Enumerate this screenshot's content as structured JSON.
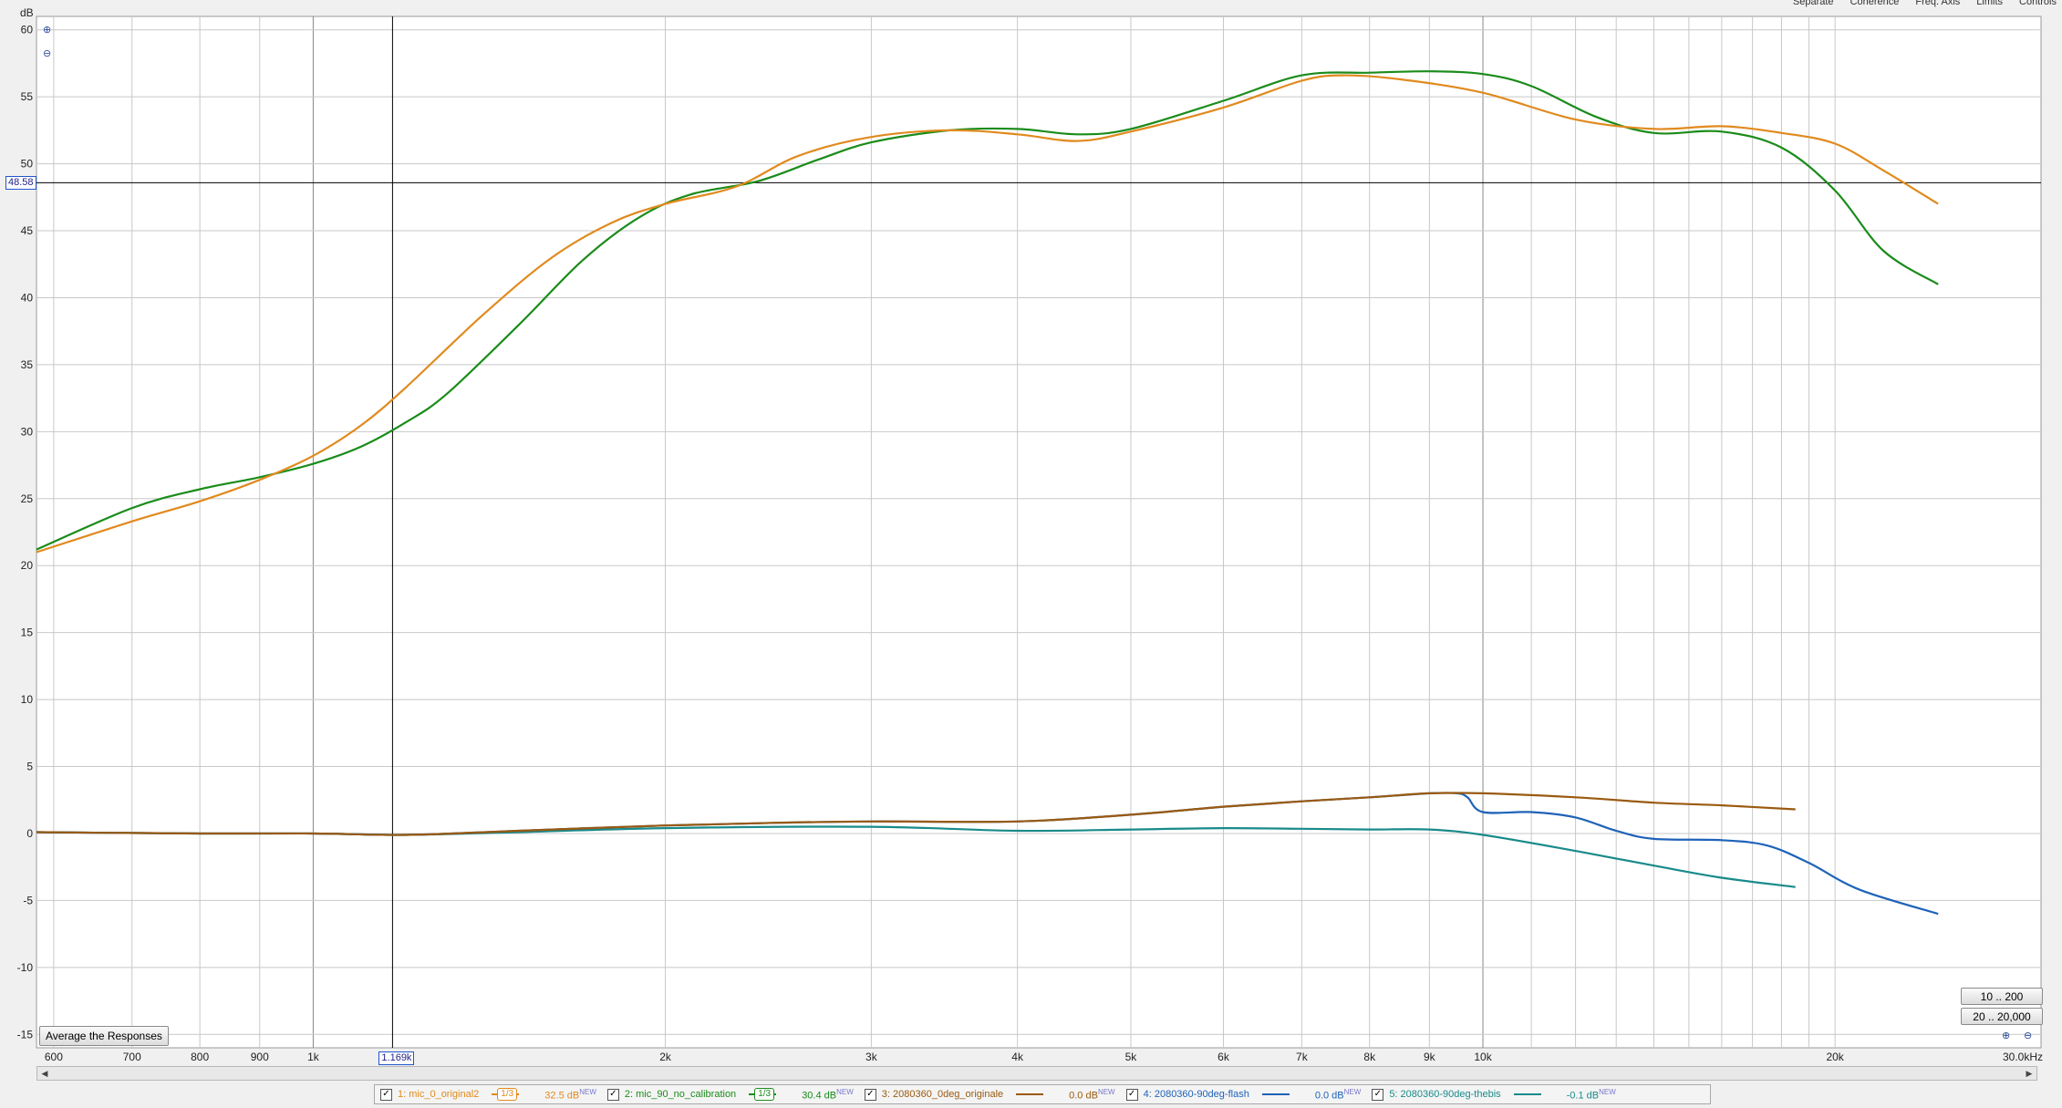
{
  "header": {
    "y_unit": "dB",
    "menu_items": [
      "Separate",
      "Coherence",
      "Freq. Axis",
      "Limits",
      "Controls"
    ]
  },
  "cursor": {
    "freq_label": "1.169k",
    "db_label": "48.58",
    "freq": 1169,
    "db": 48.58
  },
  "buttons": {
    "average": "Average the Responses",
    "range_low": "10 .. 200",
    "range_full": "20 .. 20,000"
  },
  "colors": {
    "grid": "#c8c8c8",
    "grid_major": "#888888",
    "cursor": "#000000",
    "orange": "#e08a1e",
    "green": "#1a8c1a",
    "brown": "#9a5a10",
    "blue": "#1f63b8",
    "teal": "#1a8a8a"
  },
  "legend": [
    {
      "label": "1: mic_0_original2",
      "smoothing": "1/3",
      "offset": "32.5 dB",
      "color": "#e08a1e"
    },
    {
      "label": "2: mic_90_no_calibration",
      "smoothing": "1/3",
      "offset": "30.4 dB",
      "color": "#1a8c1a"
    },
    {
      "label": "3: 2080360_0deg_originale",
      "smoothing": "",
      "offset": "0.0 dB",
      "color": "#9a5a10"
    },
    {
      "label": "4: 2080360-90deg-flash",
      "smoothing": "",
      "offset": "0.0 dB",
      "color": "#1f63b8"
    },
    {
      "label": "5: 2080360-90deg-thebis",
      "smoothing": "",
      "offset": "-0.1 dB",
      "color": "#1a8a8a"
    }
  ],
  "legend_new_tag": "NEW",
  "chart_data": {
    "type": "line",
    "title": "",
    "xlabel": "",
    "ylabel": "dB",
    "x_scale": "log",
    "xlim": [
      580,
      30000
    ],
    "ylim": [
      -16,
      61
    ],
    "grid": true,
    "x_ticks": [
      {
        "v": 600,
        "label": "600"
      },
      {
        "v": 700,
        "label": "700"
      },
      {
        "v": 800,
        "label": "800"
      },
      {
        "v": 900,
        "label": "900"
      },
      {
        "v": 1000,
        "label": "1k"
      },
      {
        "v": 2000,
        "label": "2k"
      },
      {
        "v": 3000,
        "label": "3k"
      },
      {
        "v": 4000,
        "label": "4k"
      },
      {
        "v": 5000,
        "label": "5k"
      },
      {
        "v": 6000,
        "label": "6k"
      },
      {
        "v": 7000,
        "label": "7k"
      },
      {
        "v": 8000,
        "label": "8k"
      },
      {
        "v": 9000,
        "label": "9k"
      },
      {
        "v": 10000,
        "label": "10k"
      },
      {
        "v": 20000,
        "label": "20k"
      },
      {
        "v": 30000,
        "label": "30.0kHz"
      }
    ],
    "major_x": [
      1000,
      10000
    ],
    "extra_x_grid": [
      11000,
      12000,
      13000,
      14000,
      15000,
      16000,
      17000,
      18000,
      19000
    ],
    "y_ticks": [
      60,
      55,
      50,
      45,
      40,
      35,
      30,
      25,
      20,
      15,
      10,
      5,
      0,
      -5,
      -10,
      -15
    ],
    "series": [
      {
        "name": "1: mic_0_original2",
        "color": "#e08a1e",
        "points": [
          [
            580,
            21
          ],
          [
            700,
            23.3
          ],
          [
            800,
            24.8
          ],
          [
            900,
            26.4
          ],
          [
            1000,
            28.2
          ],
          [
            1100,
            30.5
          ],
          [
            1200,
            33.3
          ],
          [
            1400,
            38.8
          ],
          [
            1600,
            43
          ],
          [
            1800,
            45.6
          ],
          [
            2000,
            47
          ],
          [
            2300,
            48.3
          ],
          [
            2600,
            50.6
          ],
          [
            3000,
            52
          ],
          [
            3500,
            52.5
          ],
          [
            4000,
            52.2
          ],
          [
            4500,
            51.7
          ],
          [
            5000,
            52.4
          ],
          [
            6000,
            54.2
          ],
          [
            7000,
            56.2
          ],
          [
            7600,
            56.6
          ],
          [
            8500,
            56.3
          ],
          [
            10000,
            55.3
          ],
          [
            12000,
            53.3
          ],
          [
            14000,
            52.6
          ],
          [
            16000,
            52.8
          ],
          [
            18000,
            52.3
          ],
          [
            20000,
            51.5
          ],
          [
            22000,
            49.5
          ],
          [
            24500,
            47
          ]
        ]
      },
      {
        "name": "2: mic_90_no_calibration",
        "color": "#1a8c1a",
        "points": [
          [
            580,
            21.2
          ],
          [
            700,
            24.3
          ],
          [
            800,
            25.7
          ],
          [
            900,
            26.6
          ],
          [
            1000,
            27.6
          ],
          [
            1100,
            28.9
          ],
          [
            1200,
            30.7
          ],
          [
            1300,
            32.8
          ],
          [
            1500,
            38
          ],
          [
            1700,
            42.8
          ],
          [
            1900,
            46
          ],
          [
            2100,
            47.7
          ],
          [
            2400,
            48.7
          ],
          [
            2700,
            50.3
          ],
          [
            3000,
            51.6
          ],
          [
            3500,
            52.5
          ],
          [
            4000,
            52.6
          ],
          [
            4500,
            52.2
          ],
          [
            5000,
            52.6
          ],
          [
            6000,
            54.7
          ],
          [
            7000,
            56.6
          ],
          [
            8000,
            56.8
          ],
          [
            9000,
            56.9
          ],
          [
            10000,
            56.7
          ],
          [
            11000,
            55.8
          ],
          [
            12500,
            53.5
          ],
          [
            14000,
            52.3
          ],
          [
            16000,
            52.4
          ],
          [
            18000,
            51.2
          ],
          [
            20000,
            48
          ],
          [
            22000,
            43.5
          ],
          [
            24500,
            41
          ]
        ]
      },
      {
        "name": "3: 2080360_0deg_originale",
        "color": "#9a5a10",
        "points": [
          [
            580,
            0.1
          ],
          [
            800,
            0
          ],
          [
            1000,
            0
          ],
          [
            1200,
            -0.1
          ],
          [
            1500,
            0.2
          ],
          [
            2000,
            0.6
          ],
          [
            2500,
            0.8
          ],
          [
            3000,
            0.9
          ],
          [
            4000,
            0.9
          ],
          [
            5000,
            1.4
          ],
          [
            6000,
            2
          ],
          [
            7000,
            2.4
          ],
          [
            8000,
            2.7
          ],
          [
            9000,
            3
          ],
          [
            10000,
            3
          ],
          [
            12000,
            2.7
          ],
          [
            14000,
            2.3
          ],
          [
            16000,
            2.1
          ],
          [
            18500,
            1.8
          ]
        ]
      },
      {
        "name": "4: 2080360-90deg-flash",
        "color": "#1f63b8",
        "points": [
          [
            580,
            0.1
          ],
          [
            800,
            0
          ],
          [
            1000,
            0
          ],
          [
            1200,
            -0.1
          ],
          [
            1500,
            0.2
          ],
          [
            2000,
            0.6
          ],
          [
            2500,
            0.8
          ],
          [
            3000,
            0.9
          ],
          [
            4000,
            0.9
          ],
          [
            5000,
            1.4
          ],
          [
            6000,
            2
          ],
          [
            7000,
            2.4
          ],
          [
            8000,
            2.7
          ],
          [
            9000,
            3
          ],
          [
            9500,
            3
          ],
          [
            9700,
            2.7
          ],
          [
            10000,
            1.6
          ],
          [
            11000,
            1.6
          ],
          [
            12000,
            1.2
          ],
          [
            13000,
            0.2
          ],
          [
            14000,
            -0.4
          ],
          [
            16000,
            -0.5
          ],
          [
            17500,
            -0.9
          ],
          [
            19000,
            -2.2
          ],
          [
            21000,
            -4.2
          ],
          [
            24500,
            -6
          ]
        ]
      },
      {
        "name": "5: 2080360-90deg-thebis",
        "color": "#1a8a8a",
        "points": [
          [
            580,
            0.1
          ],
          [
            800,
            0
          ],
          [
            1000,
            0
          ],
          [
            1200,
            -0.1
          ],
          [
            1500,
            0.1
          ],
          [
            2000,
            0.4
          ],
          [
            3000,
            0.5
          ],
          [
            4000,
            0.2
          ],
          [
            5000,
            0.3
          ],
          [
            6000,
            0.4
          ],
          [
            7000,
            0.35
          ],
          [
            8000,
            0.3
          ],
          [
            9000,
            0.3
          ],
          [
            10000,
            -0.1
          ],
          [
            12000,
            -1.3
          ],
          [
            14000,
            -2.4
          ],
          [
            16000,
            -3.3
          ],
          [
            18500,
            -4
          ]
        ]
      }
    ]
  }
}
